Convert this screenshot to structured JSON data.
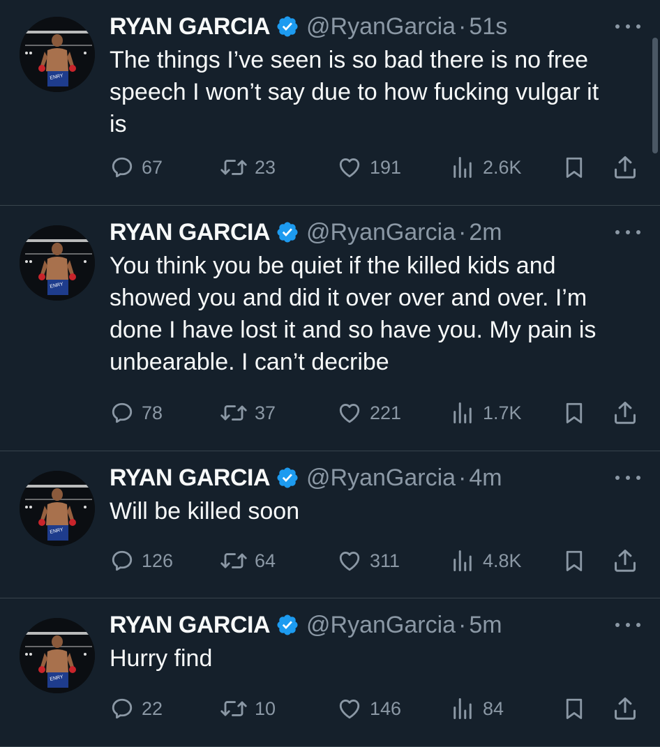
{
  "accent_colors": {
    "background": "#15202b",
    "verified_badge": "#1d9bf0",
    "secondary_text": "#8b98a5",
    "divider": "#38444d"
  },
  "icons": {
    "reply": "speech-bubble-icon",
    "retweet": "retweet-arrows-icon",
    "like": "heart-icon",
    "views": "bar-chart-icon",
    "bookmark": "bookmark-icon",
    "share": "share-upload-icon",
    "more": "three-dots-icon",
    "verified": "verified-badge-icon"
  },
  "tweets": [
    {
      "name": "RYAN GARCIA",
      "handle": "@RyanGarcia",
      "separator": "·",
      "time": "51s",
      "text": "The things I’ve seen is so bad there is no free\nspeech I won’t say due to how fucking vulgar it\nis",
      "stats": {
        "replies": "67",
        "retweets": "23",
        "likes": "191",
        "views": "2.6K"
      }
    },
    {
      "name": "RYAN GARCIA",
      "handle": "@RyanGarcia",
      "separator": "·",
      "time": "2m",
      "text": "You think you be quiet if the killed kids and\nshowed you and did it over over and over. I’m\ndone I have lost it and so have you. My pain is\nunbearable. I can’t decribe",
      "stats": {
        "replies": "78",
        "retweets": "37",
        "likes": "221",
        "views": "1.7K"
      }
    },
    {
      "name": "RYAN GARCIA",
      "handle": "@RyanGarcia",
      "separator": "·",
      "time": "4m",
      "text": "Will be killed soon",
      "stats": {
        "replies": "126",
        "retweets": "64",
        "likes": "311",
        "views": "4.8K"
      }
    },
    {
      "name": "RYAN GARCIA",
      "handle": "@RyanGarcia",
      "separator": "·",
      "time": "5m",
      "text": "Hurry find",
      "stats": {
        "replies": "22",
        "retweets": "10",
        "likes": "146",
        "views": "84"
      }
    }
  ]
}
